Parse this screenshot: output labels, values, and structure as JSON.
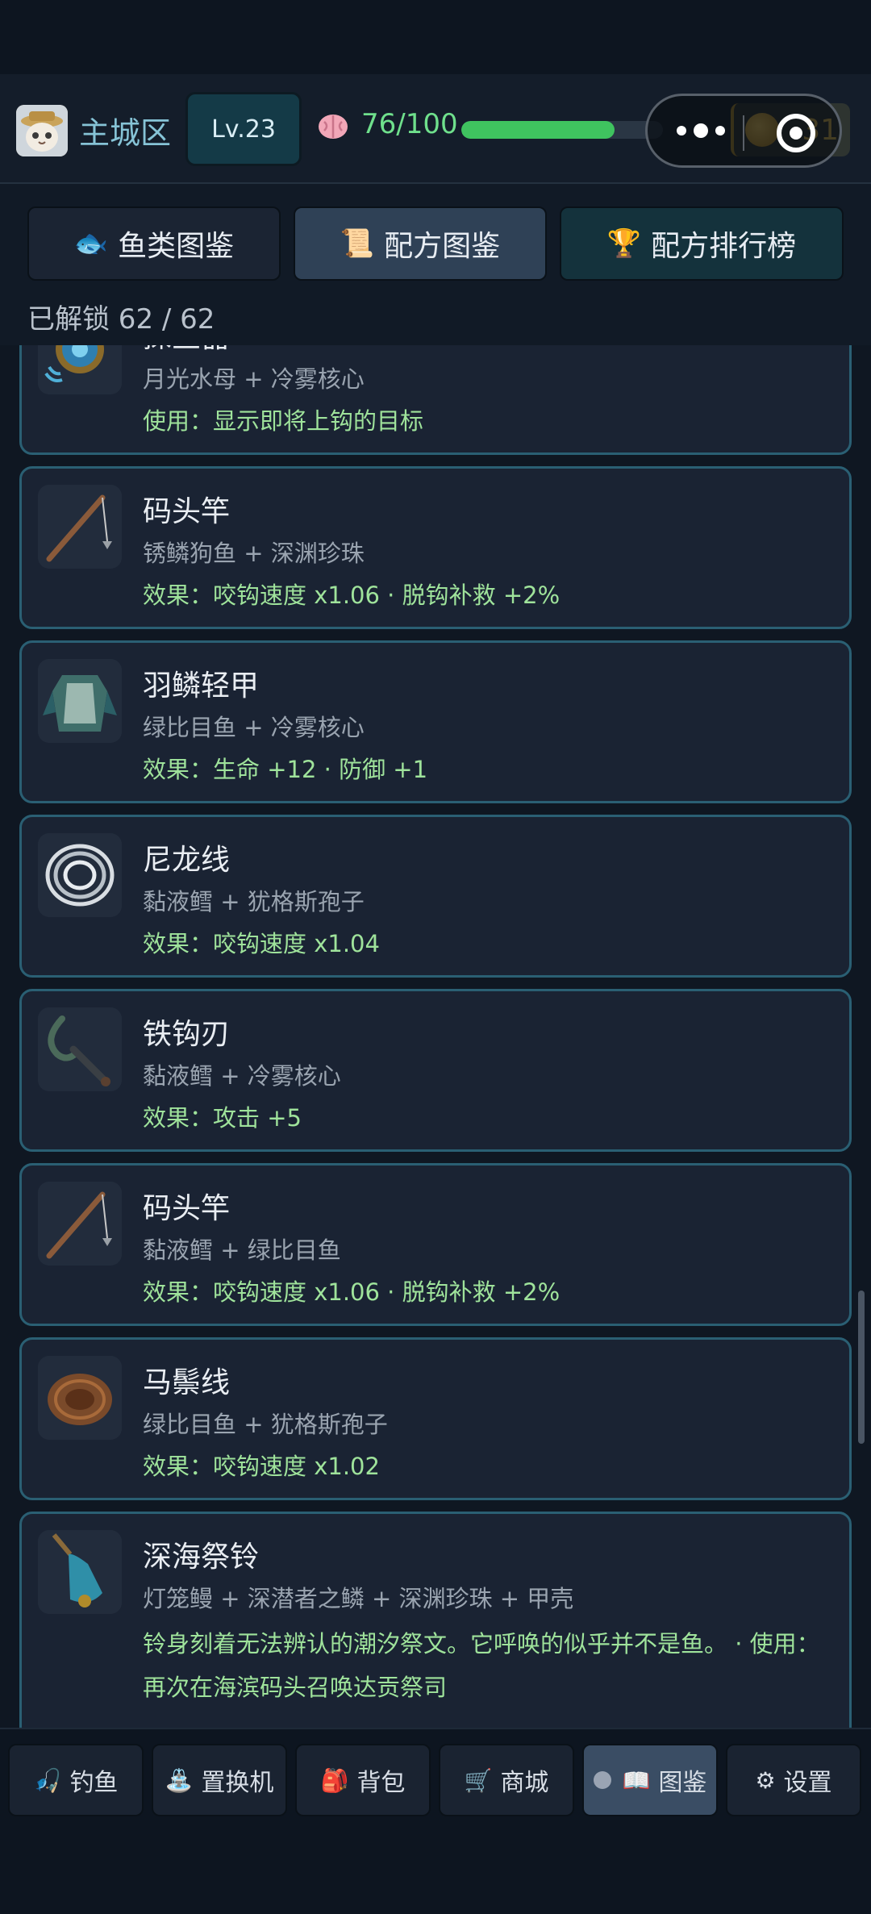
{
  "header": {
    "zone": "主城区",
    "level": "Lv.23",
    "energy": "76/100",
    "energy_progress": 0.76,
    "coins": "31"
  },
  "tabs": [
    {
      "label": "鱼类图鉴",
      "icon": "🐟"
    },
    {
      "label": "配方图鉴",
      "icon": "📜"
    },
    {
      "label": "配方排行榜",
      "icon": "🏆"
    }
  ],
  "unlocked": "已解锁 62 / 62",
  "recipes": [
    {
      "name": "探鱼器",
      "recipe": "月光水母 + 冷雾核心",
      "effect": "使用：显示即将上钩的目标",
      "icon": "detector-icon"
    },
    {
      "name": "码头竿",
      "recipe": "锈鳞狗鱼 + 深渊珍珠",
      "effect": "效果：咬钩速度 x1.06 · 脱钩补救 +2%",
      "icon": "fishing-rod-icon"
    },
    {
      "name": "羽鳞轻甲",
      "recipe": "绿比目鱼 + 冷雾核心",
      "effect": "效果：生命 +12 · 防御 +1",
      "icon": "armor-icon"
    },
    {
      "name": "尼龙线",
      "recipe": "黏液鳕 + 犹格斯孢子",
      "effect": "效果：咬钩速度 x1.04",
      "icon": "nylon-line-icon"
    },
    {
      "name": "铁钩刃",
      "recipe": "黏液鳕 + 冷雾核心",
      "effect": "效果：攻击 +5",
      "icon": "hook-blade-icon"
    },
    {
      "name": "码头竿",
      "recipe": "黏液鳕 + 绿比目鱼",
      "effect": "效果：咬钩速度 x1.06 · 脱钩补救 +2%",
      "icon": "fishing-rod-icon"
    },
    {
      "name": "马鬃线",
      "recipe": "绿比目鱼 + 犹格斯孢子",
      "effect": "效果：咬钩速度 x1.02",
      "icon": "horsehair-line-icon"
    },
    {
      "name": "深海祭铃",
      "recipe": "灯笼鳗 + 深潜者之鳞 + 深渊珍珠 + 甲壳",
      "effect": "铃身刻着无法辨认的潮汐祭文。它呼唤的似乎并不是鱼。 · 使用：再次在海滨码头召唤达贡祭司",
      "icon": "bell-icon"
    }
  ],
  "nav": [
    {
      "label": "钓鱼",
      "icon": "🎣"
    },
    {
      "label": "置换机",
      "icon": "⛲"
    },
    {
      "label": "背包",
      "icon": "🎒"
    },
    {
      "label": "商城",
      "icon": "🛒"
    },
    {
      "label": "图鉴",
      "icon": "📖"
    },
    {
      "label": "设置",
      "icon": "⚙"
    }
  ]
}
